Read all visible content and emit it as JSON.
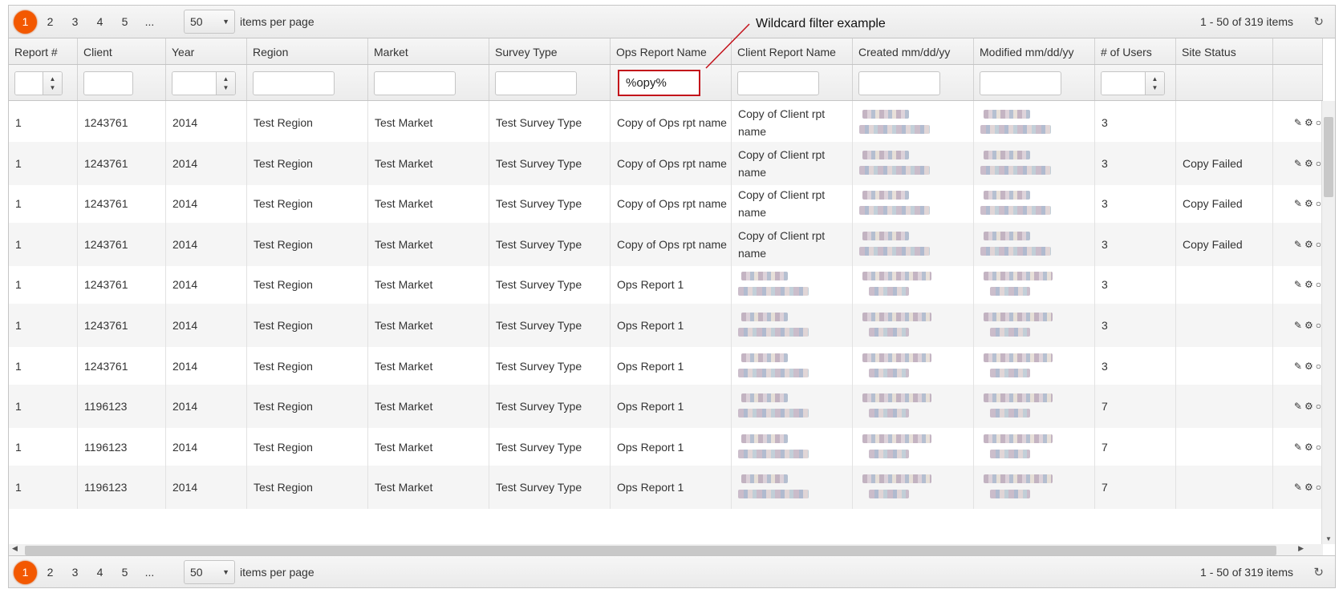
{
  "pager": {
    "pages": [
      "1",
      "2",
      "3",
      "4",
      "5",
      "..."
    ],
    "active_page": "1",
    "page_size": "50",
    "items_per_page_label": "items per page",
    "info": "1 - 50 of 319 items"
  },
  "annotation": "Wildcard filter example",
  "columns": [
    "Report #",
    "Client",
    "Year",
    "Region",
    "Market",
    "Survey Type",
    "Ops Report Name",
    "Client Report Name",
    "Created mm/dd/yy",
    "Modified mm/dd/yy",
    "# of Users",
    "Site Status"
  ],
  "filters": {
    "ops_report_name": "%opy%"
  },
  "rows": [
    {
      "report": "1",
      "client": "1243761",
      "year": "2014",
      "region": "Test Region",
      "market": "Test Market",
      "survey": "Test Survey Type",
      "ops": "Copy of Ops rpt name",
      "client_report": "Copy of Client rpt name",
      "users": "3",
      "status": ""
    },
    {
      "report": "1",
      "client": "1243761",
      "year": "2014",
      "region": "Test Region",
      "market": "Test Market",
      "survey": "Test Survey Type",
      "ops": "Copy of Ops rpt name",
      "client_report": "Copy of Client rpt name",
      "users": "3",
      "status": "Copy Failed"
    },
    {
      "report": "1",
      "client": "1243761",
      "year": "2014",
      "region": "Test Region",
      "market": "Test Market",
      "survey": "Test Survey Type",
      "ops": "Copy of Ops rpt name",
      "client_report": "Copy of Client rpt name",
      "users": "3",
      "status": "Copy Failed"
    },
    {
      "report": "1",
      "client": "1243761",
      "year": "2014",
      "region": "Test Region",
      "market": "Test Market",
      "survey": "Test Survey Type",
      "ops": "Copy of Ops rpt name",
      "client_report": "Copy of Client rpt name",
      "users": "3",
      "status": "Copy Failed"
    },
    {
      "report": "1",
      "client": "1243761",
      "year": "2014",
      "region": "Test Region",
      "market": "Test Market",
      "survey": "Test Survey Type",
      "ops": "Ops Report 1",
      "client_report": "",
      "users": "3",
      "status": ""
    },
    {
      "report": "1",
      "client": "1243761",
      "year": "2014",
      "region": "Test Region",
      "market": "Test Market",
      "survey": "Test Survey Type",
      "ops": "Ops Report 1",
      "client_report": "",
      "users": "3",
      "status": ""
    },
    {
      "report": "1",
      "client": "1243761",
      "year": "2014",
      "region": "Test Region",
      "market": "Test Market",
      "survey": "Test Survey Type",
      "ops": "Ops Report 1",
      "client_report": "",
      "users": "3",
      "status": ""
    },
    {
      "report": "1",
      "client": "1196123",
      "year": "2014",
      "region": "Test Region",
      "market": "Test Market",
      "survey": "Test Survey Type",
      "ops": "Ops Report 1",
      "client_report": "",
      "users": "7",
      "status": ""
    },
    {
      "report": "1",
      "client": "1196123",
      "year": "2014",
      "region": "Test Region",
      "market": "Test Market",
      "survey": "Test Survey Type",
      "ops": "Ops Report 1",
      "client_report": "",
      "users": "7",
      "status": ""
    },
    {
      "report": "1",
      "client": "1196123",
      "year": "2014",
      "region": "Test Region",
      "market": "Test Market",
      "survey": "Test Survey Type",
      "ops": "Ops Report 1",
      "client_report": "",
      "users": "7",
      "status": ""
    }
  ],
  "row_icons": [
    "pencil-icon",
    "gear-icon",
    "circle-icon"
  ],
  "colors": {
    "active_page": "#f35800",
    "highlight_border": "#c3111a"
  }
}
